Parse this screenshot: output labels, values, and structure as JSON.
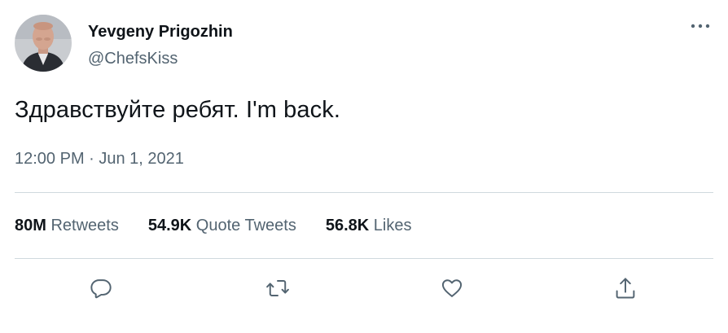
{
  "author": {
    "display_name": "Yevgeny Prigozhin",
    "handle": "@ChefsKiss"
  },
  "tweet": {
    "text": "Здравствуйте ребят. I'm back.",
    "timestamp": "12:00 PM · Jun 1, 2021"
  },
  "stats": {
    "retweets": {
      "count": "80M",
      "label": "Retweets"
    },
    "quote_tweets": {
      "count": "54.9K",
      "label": "Quote Tweets"
    },
    "likes": {
      "count": "56.8K",
      "label": "Likes"
    }
  },
  "actions": {
    "reply_icon": "reply-icon",
    "retweet_icon": "retweet-icon",
    "like_icon": "heart-icon",
    "share_icon": "share-icon"
  },
  "colors": {
    "text_primary": "#0f1419",
    "text_secondary": "#536471",
    "divider": "#cfd9de"
  }
}
